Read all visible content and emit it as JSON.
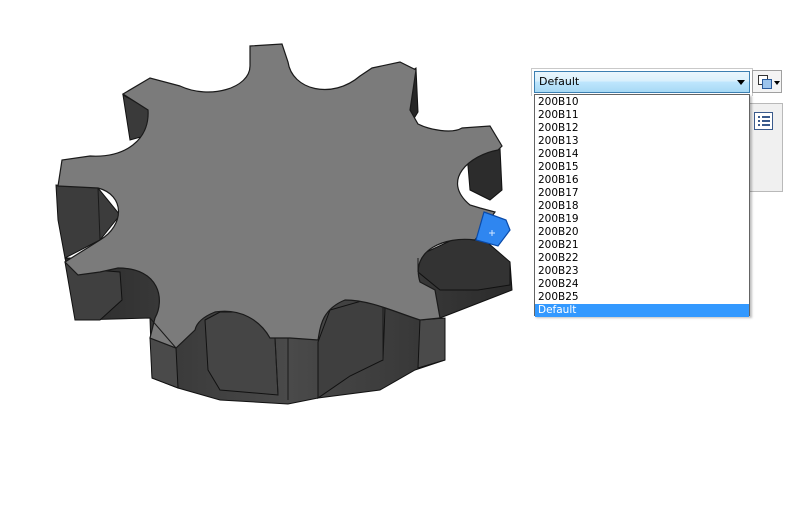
{
  "configuration": {
    "selected_value": "Default",
    "options": [
      "200B10",
      "200B11",
      "200B12",
      "200B13",
      "200B14",
      "200B15",
      "200B16",
      "200B17",
      "200B18",
      "200B19",
      "200B20",
      "200B21",
      "200B22",
      "200B23",
      "200B24",
      "200B25",
      "Default"
    ],
    "highlighted_option": "Default"
  },
  "colors": {
    "gear_top": "#7c7c7c",
    "gear_side": "#3a3a3a",
    "selected_face": "#2f86f0",
    "dropdown_highlight": "#3399ff"
  },
  "icons": {
    "config_button": "configurations-icon",
    "panel": "property-list-icon"
  }
}
